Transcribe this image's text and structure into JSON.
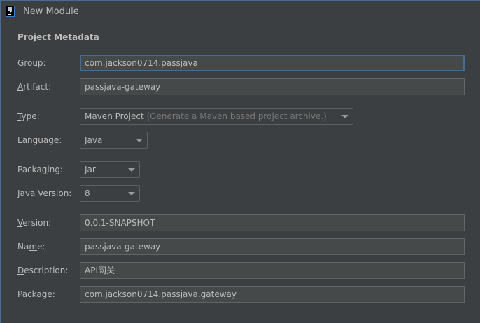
{
  "window": {
    "title": "New Module"
  },
  "section_title": "Project Metadata",
  "fields": {
    "group": {
      "label_u": "G",
      "label_rest": "roup:",
      "value": "com.jackson0714.passjava"
    },
    "artifact": {
      "label_u": "A",
      "label_rest": "rtifact:",
      "value": "passjava-gateway"
    },
    "type": {
      "label_u": "T",
      "label_rest": "ype:",
      "value": "Maven Project",
      "hint": "(Generate a Maven based project archive.)"
    },
    "language": {
      "label_u": "L",
      "label_rest": "anguage:",
      "value": "Java"
    },
    "packaging": {
      "label_pre": "Packa",
      "label_u": "g",
      "label_rest": "ing:",
      "value": "Jar"
    },
    "java_version": {
      "label_u": "J",
      "label_rest": "ava Version:",
      "value": "8"
    },
    "version": {
      "label_u": "V",
      "label_rest": "ersion:",
      "value": "0.0.1-SNAPSHOT"
    },
    "name": {
      "label_pre": "Na",
      "label_u": "m",
      "label_rest": "e:",
      "value": "passjava-gateway"
    },
    "description": {
      "label_u": "D",
      "label_rest": "escription:",
      "value": "API网关"
    },
    "package": {
      "label_pre": "Pac",
      "label_u": "k",
      "label_rest": "age:",
      "value": "com.jackson0714.passjava.gateway"
    }
  }
}
